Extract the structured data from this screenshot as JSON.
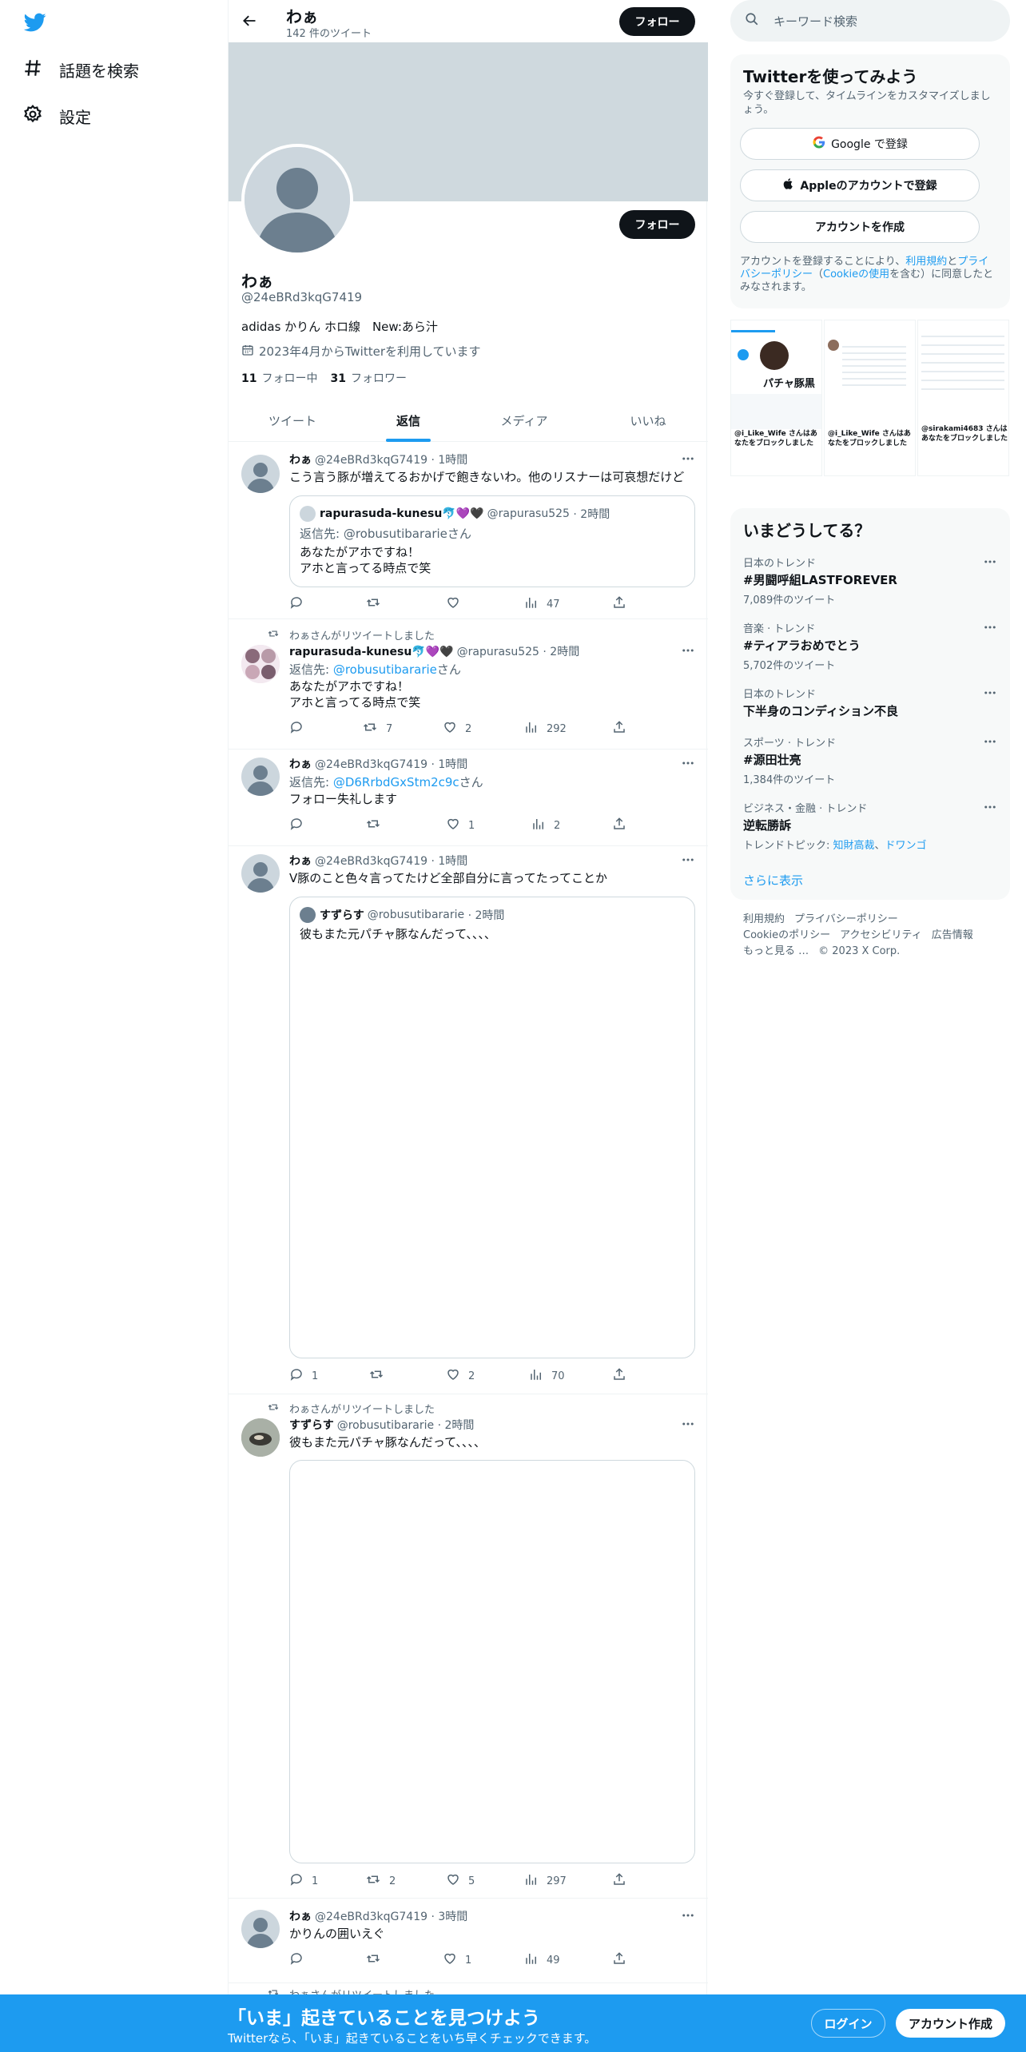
{
  "nav": {
    "explore_label": "話題を検索",
    "settings_label": "設定"
  },
  "header": {
    "name": "わぁ",
    "tweet_count": "142 件のツイート",
    "follow_label": "フォロー"
  },
  "profile": {
    "name": "わぁ",
    "handle": "@24eBRd3kqG7419",
    "bio": "adidas かりん ホロ線　New:あら汁",
    "joined": "2023年4月からTwitterを利用しています",
    "following_count": "11",
    "following_label": "フォロー中",
    "followers_count": "31",
    "followers_label": "フォロワー",
    "follow_label": "フォロー"
  },
  "tabs": [
    "ツイート",
    "返信",
    "メディア",
    "いいね"
  ],
  "tweets": {
    "t1": {
      "name": "わぁ",
      "handle": "@24eBRd3kqG7419",
      "time": "· 1時間",
      "text": "こう言う豚が増えてるおかげで飽きないわ。他のリスナーは可哀想だけど",
      "quote": {
        "name": "rapurasuda-kunesu🐬💜🖤",
        "handle": "@rapurasu525",
        "time": "· 2時間",
        "reply_prefix": "返信先: ",
        "reply_to": "@robusutibararie",
        "reply_suffix": "さん",
        "text": "あなたがアホですね！\nアホと言ってる時点で笑"
      },
      "reply": "",
      "rt": "",
      "like": "",
      "views": "47"
    },
    "t2": {
      "rt_label": "わぁさんがリツイートしました",
      "name": "rapurasuda-kunesu🐬💜🖤",
      "handle": "@rapurasu525",
      "time": "· 2時間",
      "reply_prefix": "返信先: ",
      "reply_to": "@robusutibararie",
      "reply_suffix": "さん",
      "text": "あなたがアホですね！\nアホと言ってる時点で笑",
      "reply": "",
      "rt": "7",
      "like": "2",
      "views": "292"
    },
    "t3": {
      "name": "わぁ",
      "handle": "@24eBRd3kqG7419",
      "time": "· 1時間",
      "reply_prefix": "返信先: ",
      "reply_to": "@D6RrbdGxStm2c9c",
      "reply_suffix": "さん",
      "text": "フォロー失礼します",
      "reply": "",
      "rt": "",
      "like": "1",
      "views": "2"
    },
    "t4": {
      "name": "わぁ",
      "handle": "@24eBRd3kqG7419",
      "time": "· 1時間",
      "text": "V豚のこと色々言ってたけど全部自分に言ってたってことか",
      "quote": {
        "name": "すずらす",
        "handle": "@robusutibararie",
        "time": "· 2時間",
        "text": "彼もまた元パチャ豚なんだって、、、、"
      },
      "reply": "1",
      "rt": "",
      "like": "2",
      "views": "70"
    },
    "t5": {
      "rt_label": "わぁさんがリツイートしました",
      "name": "すずらす",
      "handle": "@robusutibararie",
      "time": "· 2時間",
      "text": "彼もまた元パチャ豚なんだって、、、、",
      "reply": "1",
      "rt": "2",
      "like": "5",
      "views": "297"
    },
    "t6": {
      "name": "わぁ",
      "handle": "@24eBRd3kqG7419",
      "time": "· 3時間",
      "text": "かりんの囲いえぐ",
      "reply": "",
      "rt": "",
      "like": "1",
      "views": "49"
    },
    "t7": {
      "rt_label": "わぁさんがリツイートしました"
    }
  },
  "right": {
    "search_placeholder": "キーワード検索",
    "signup": {
      "title": "Twitterを使ってみよう",
      "sub": "今すぐ登録して、タイムラインをカスタマイズしましょう。",
      "google": "Google で登録",
      "apple": "Appleのアカウントで登録",
      "create": "アカウントを作成",
      "legal_1": "アカウントを登録することにより、",
      "legal_terms": "利用規約",
      "legal_2": "と",
      "legal_privacy": "プライバシーポリシー",
      "legal_3": "（",
      "legal_cookie": "Cookieの使用",
      "legal_4": "を含む）に同意したとみなされます。"
    },
    "media_strip": {
      "m1_name": "パチャ豚黒",
      "m1_caption": "@i_Like_Wife さんはあなたをブロックしました",
      "m2_caption": "@i_Like_Wife さんはあなたをブロックしました",
      "m3_caption": "@sirakami4683 さんはあなたをブロックしました"
    },
    "trends": {
      "title": "いまどうしてる？",
      "items": [
        {
          "ctx": "日本のトレンド",
          "name": "#男闘呼組LASTFOREVER",
          "count": "7,089件のツイート"
        },
        {
          "ctx": "音楽 · トレンド",
          "name": "#ティアラおめでとう",
          "count": "5,702件のツイート"
        },
        {
          "ctx": "日本のトレンド",
          "name": "下半身のコンディション不良",
          "count": ""
        },
        {
          "ctx": "スポーツ · トレンド",
          "name": "#源田壮亮",
          "count": "1,384件のツイート"
        },
        {
          "ctx": "ビジネス・金融 · トレンド",
          "name": "逆転勝訴",
          "count": ""
        }
      ],
      "topic_prefix": "トレンドトピック: ",
      "topic_1": "知財高裁",
      "topic_sep": "、",
      "topic_2": "ドワンゴ",
      "show_more": "さらに表示"
    },
    "footer": [
      "利用規約",
      "プライバシーポリシー",
      "Cookieのポリシー",
      "アクセシビリティ",
      "広告情報",
      "もっと見る …",
      "© 2023 X Corp."
    ]
  },
  "bottom": {
    "title": "「いま」起きていることを見つけよう",
    "sub": "Twitterなら、「いま」起きていることをいち早くチェックできます。",
    "login": "ログイン",
    "signup": "アカウント作成"
  },
  "colors": {
    "accent": "#1d9bf0",
    "text": "#0f1419",
    "muted": "#536471",
    "banner": "#cfd9de"
  }
}
